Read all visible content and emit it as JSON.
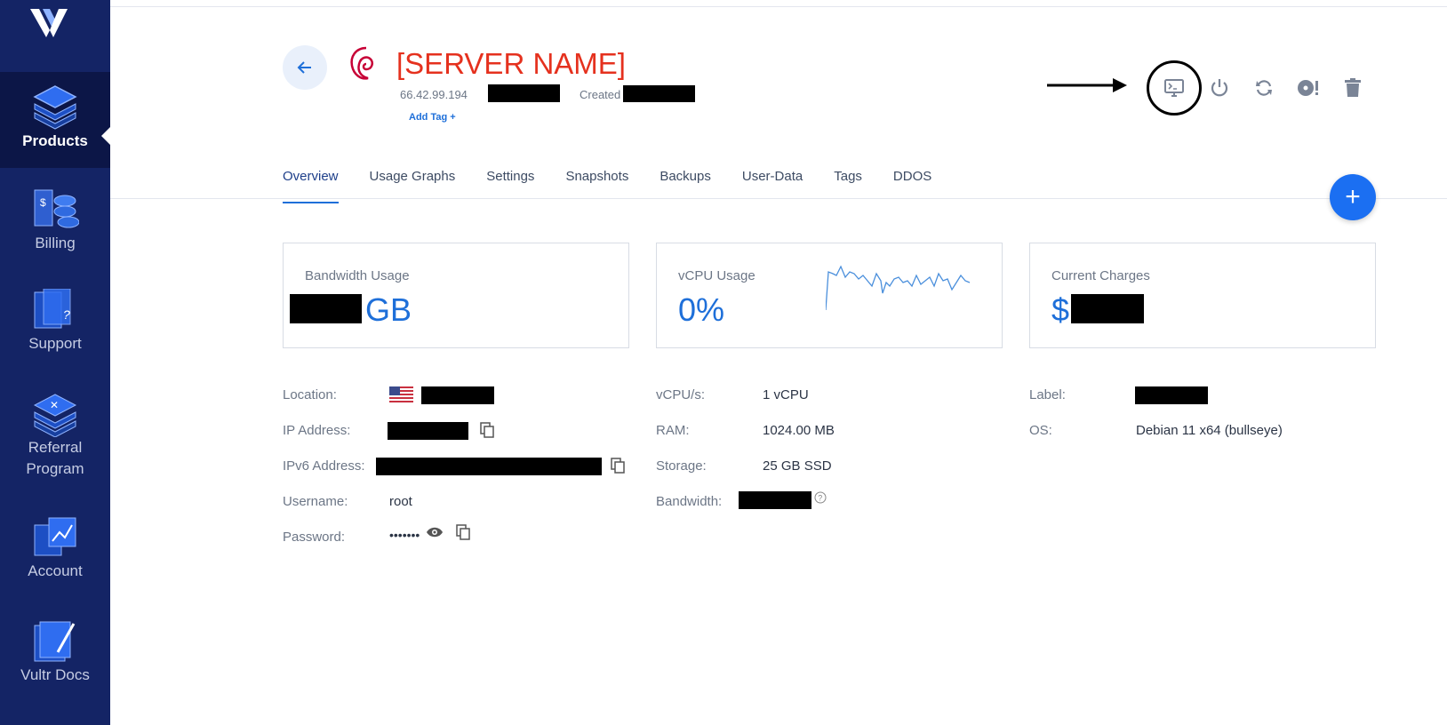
{
  "sidebar": {
    "items": [
      {
        "label": "Products",
        "icon": "products-icon",
        "active": true
      },
      {
        "label": "Billing",
        "icon": "billing-icon"
      },
      {
        "label": "Support",
        "icon": "support-icon"
      },
      {
        "label": "Referral Program",
        "icon": "referral-icon"
      },
      {
        "label": "Account",
        "icon": "account-icon"
      },
      {
        "label": "Vultr Docs",
        "icon": "docs-icon"
      }
    ]
  },
  "header": {
    "server_name": "[SERVER NAME]",
    "ip": "66.42.99.194",
    "created_label": "Created",
    "add_tag": "Add Tag +"
  },
  "tabs": [
    {
      "label": "Overview",
      "active": true
    },
    {
      "label": "Usage Graphs"
    },
    {
      "label": "Settings"
    },
    {
      "label": "Snapshots"
    },
    {
      "label": "Backups"
    },
    {
      "label": "User-Data"
    },
    {
      "label": "Tags"
    },
    {
      "label": "DDOS"
    }
  ],
  "cards": {
    "bandwidth": {
      "title": "Bandwidth Usage",
      "unit": "GB"
    },
    "vcpu": {
      "title": "vCPU Usage",
      "value": "0%"
    },
    "charges": {
      "title": "Current Charges",
      "prefix": "$"
    }
  },
  "details": {
    "location_label": "Location:",
    "ip_label": "IP Address:",
    "ipv6_label": "IPv6 Address:",
    "username_label": "Username:",
    "username": "root",
    "password_label": "Password:",
    "password": "•••••••",
    "vcpus_label": "vCPU/s:",
    "vcpus": "1 vCPU",
    "ram_label": "RAM:",
    "ram": "1024.00 MB",
    "storage_label": "Storage:",
    "storage": "25 GB SSD",
    "bandwidth_label": "Bandwidth:",
    "label_label": "Label:",
    "os_label": "OS:",
    "os": "Debian 11 x64 (bullseye)"
  },
  "colors": {
    "sidebar": "#142465",
    "accent": "#1e6fd9",
    "server_name": "#e5311e"
  }
}
